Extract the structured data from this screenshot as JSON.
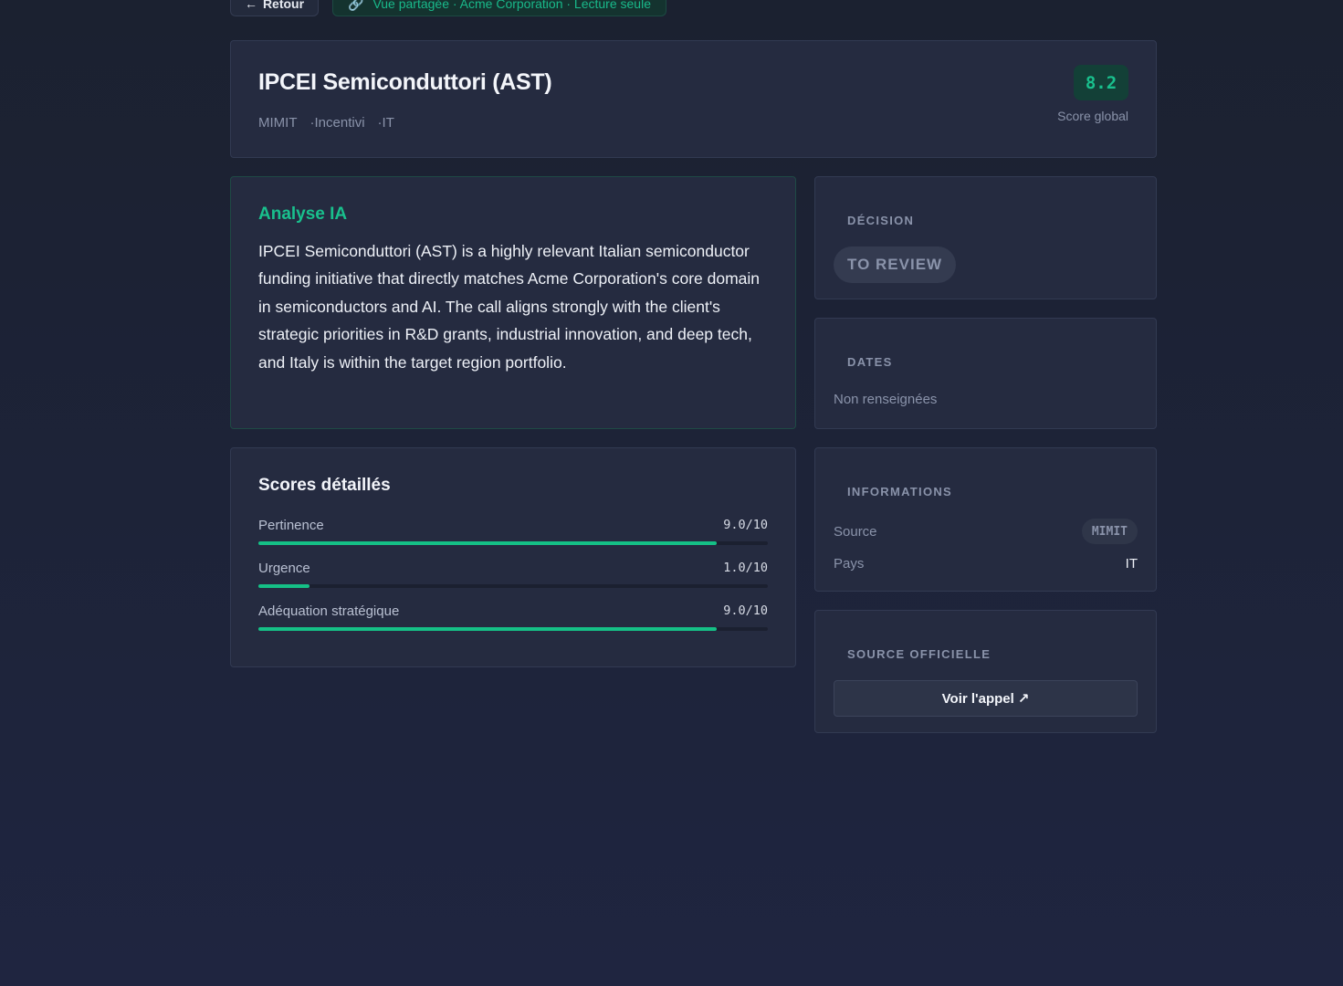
{
  "topbar": {
    "back_label": "Retour",
    "back_icon": "arrow-left-icon",
    "shared_label": "Vue partagée · Acme Corporation · Lecture seule",
    "shared_icon": "link-icon"
  },
  "header": {
    "title": "IPCEI Semiconduttori (AST)",
    "meta": [
      "MIMIT",
      "·Incentivi",
      "·IT"
    ],
    "score": "8.2",
    "score_label": "Score global"
  },
  "analysis": {
    "title": "Analyse IA",
    "text": "IPCEI Semiconduttori (AST) is a highly relevant Italian semiconductor funding initiative that directly matches Acme Corporation's core domain in semiconductors and AI. The call aligns strongly with the client's strategic priorities in R&D grants, industrial innovation, and deep tech, and Italy is within the target region portfolio."
  },
  "scores": {
    "title": "Scores détaillés",
    "items": [
      {
        "label": "Pertinence",
        "value": "9.0/10",
        "fraction": 0.9
      },
      {
        "label": "Urgence",
        "value": "1.0/10",
        "fraction": 0.1
      },
      {
        "label": "Adéquation stratégique",
        "value": "9.0/10",
        "fraction": 0.9
      }
    ]
  },
  "decision": {
    "title": "DÉCISION",
    "status": "TO REVIEW"
  },
  "dates": {
    "title": "DATES",
    "text": "Non renseignées"
  },
  "info": {
    "title": "INFORMATIONS",
    "source_label": "Source",
    "source_value": "MIMIT",
    "country_label": "Pays",
    "country_value": "IT"
  },
  "official": {
    "title": "SOURCE OFFICIELLE",
    "button_label": "Voir l'appel",
    "button_icon": "external-link-icon"
  },
  "colors": {
    "accent": "#19c08d",
    "background": "#1f2540",
    "card": "#252b40"
  }
}
